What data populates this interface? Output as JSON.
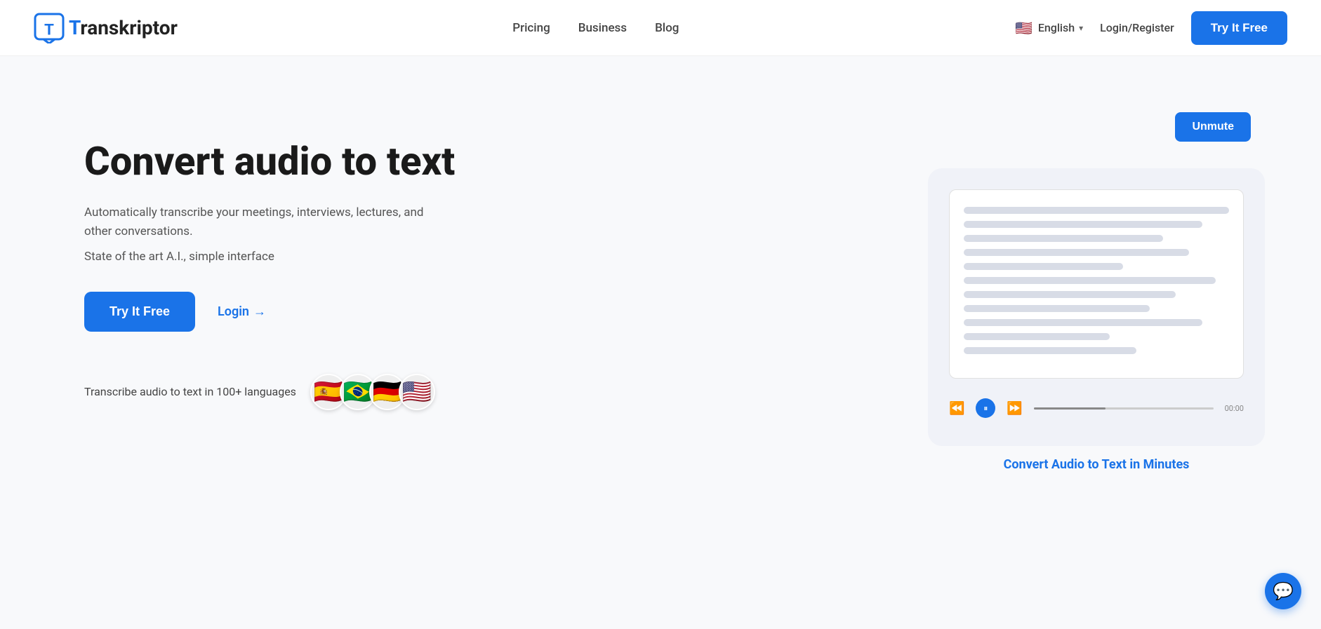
{
  "nav": {
    "logo_text_highlight": "T",
    "logo_text_rest": "ranskriptor",
    "links": [
      {
        "label": "Pricing",
        "href": "#"
      },
      {
        "label": "Business",
        "href": "#"
      },
      {
        "label": "Blog",
        "href": "#"
      }
    ],
    "language": "English",
    "login_register": "Login/Register",
    "try_free_label": "Try It Free"
  },
  "hero": {
    "title": "Convert audio to text",
    "desc1": "Automatically transcribe your meetings, interviews, lectures, and other conversations.",
    "desc2": "State of the art A.I., simple interface",
    "cta_primary": "Try It Free",
    "cta_secondary": "Login",
    "languages_text": "Transcribe audio to text in 100+ languages",
    "flags": [
      "🇪🇸",
      "🇧🇷",
      "🇩🇪",
      "🇺🇸"
    ]
  },
  "video_panel": {
    "unmute_label": "Unmute",
    "convert_caption": "Convert Audio to Text in Minutes",
    "player_time": "00:00"
  },
  "chat": {
    "icon": "💬"
  }
}
